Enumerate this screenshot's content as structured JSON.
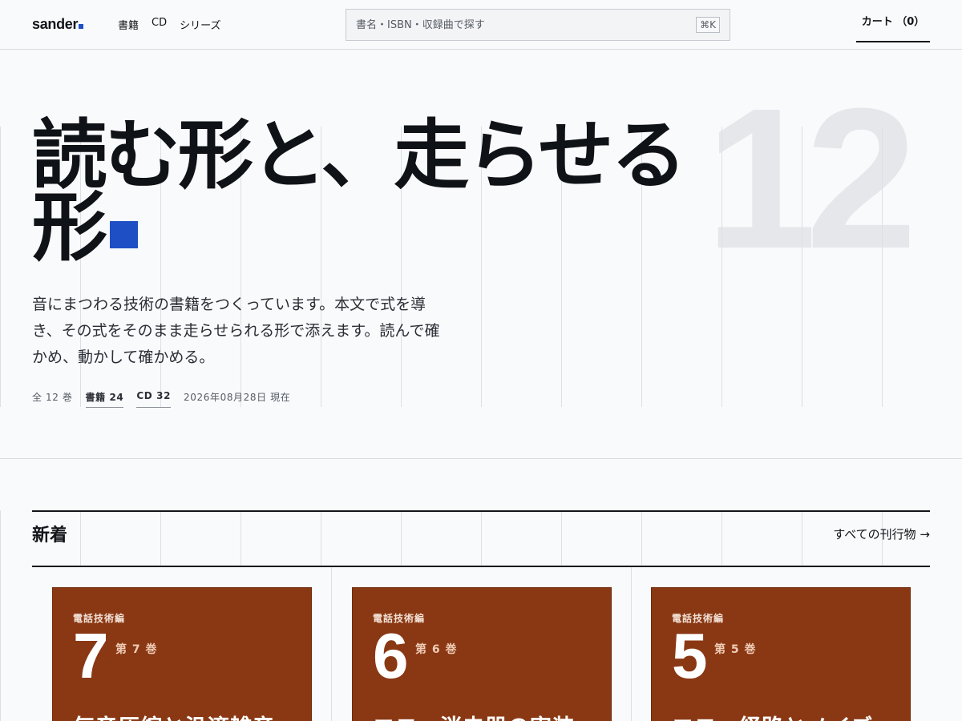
{
  "header": {
    "logo": "sander",
    "nav": [
      {
        "label": "書籍"
      },
      {
        "label": "CD"
      },
      {
        "label": "シリーズ"
      }
    ],
    "search": {
      "placeholder": "書名・ISBN・収録曲で探す",
      "shortcut": "⌘K"
    },
    "cart_label": "カート （0）"
  },
  "hero": {
    "title_line1": "読む形と、走らせる",
    "title_line2": "形",
    "big_number": "12",
    "lead": "音にまつわる技術の書籍をつくっています。本文で式を導き、その式をそのまま走らせられる形で添えます。読んで確かめ、動かして確かめる。",
    "meta": {
      "total": "全 12 巻",
      "books": "書籍 24",
      "cds": "CD 32",
      "date": "2026年08月28日 現在"
    }
  },
  "new_section": {
    "title": "新着",
    "all_link": "すべての刊行物 →",
    "cards": [
      {
        "series": "電話技術編",
        "number": "7",
        "volume": "第 7 巻",
        "title": "気音圧縮と汎適雑音"
      },
      {
        "series": "電話技術編",
        "number": "6",
        "volume": "第 6 巻",
        "title": "エコー消去器の実装"
      },
      {
        "series": "電話技術編",
        "number": "5",
        "volume": "第 5 巻",
        "title": "エコー経路とノイズ"
      }
    ]
  },
  "colors": {
    "accent": "#1f4fc4",
    "card": "#8a3813"
  }
}
